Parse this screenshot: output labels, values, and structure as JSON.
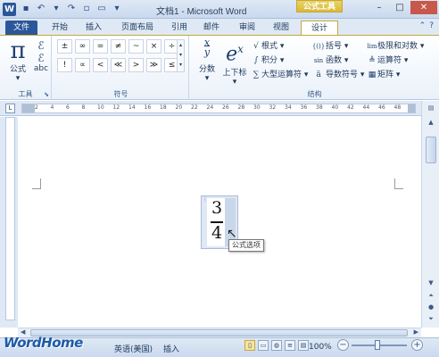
{
  "window": {
    "title": "文档1 - Microsoft Word",
    "context_tool": "公式工具",
    "app_logo": "W"
  },
  "tabs": [
    {
      "label": "文件"
    },
    {
      "label": "开始"
    },
    {
      "label": "插入"
    },
    {
      "label": "页面布局"
    },
    {
      "label": "引用"
    },
    {
      "label": "邮件"
    },
    {
      "label": "审阅"
    },
    {
      "label": "视图"
    },
    {
      "label": "设计"
    }
  ],
  "ribbon": {
    "tools": {
      "formula_label": "公式",
      "formula_symbol": "π",
      "abc_label": "abc",
      "group_label": "工具"
    },
    "symbols": {
      "group_label": "符号",
      "items": [
        "±",
        "∞",
        "=",
        "≠",
        "~",
        "×",
        "÷",
        "!",
        "∝",
        "<",
        "≪",
        ">",
        "≫",
        "≤"
      ]
    },
    "structures": {
      "group_label": "结构",
      "fraction": {
        "label": "分数",
        "icon": "x/y"
      },
      "script": {
        "label": "上下标",
        "icon": "eˣ"
      },
      "radical": {
        "label": "根式",
        "icon": "ⁿ√x"
      },
      "integral": {
        "label": "积分",
        "icon": "∫"
      },
      "large_operator": {
        "label": "大型运算符",
        "icon": "∑"
      },
      "bracket": {
        "label": "括号",
        "icon": "{()}"
      },
      "function": {
        "label": "函数",
        "icon": "sin"
      },
      "accent": {
        "label": "导数符号",
        "icon": "ä"
      },
      "limit_log": {
        "label": "极限和对数",
        "icon": "lim"
      },
      "operator": {
        "label": "运算符",
        "icon": "≜"
      },
      "matrix": {
        "label": "矩阵",
        "icon": "[]"
      }
    }
  },
  "ruler": {
    "numbers": [
      "2",
      "4",
      "6",
      "8",
      "10",
      "12",
      "14",
      "16",
      "18",
      "20",
      "22",
      "24",
      "26",
      "28",
      "30",
      "32",
      "34",
      "36",
      "38",
      "40",
      "42",
      "44",
      "46",
      "48"
    ]
  },
  "equation": {
    "numerator": "3",
    "denominator": "4",
    "tooltip": "公式选项"
  },
  "status": {
    "watermark": "WordHome",
    "language": "英语(美国)",
    "insert_mode": "插入",
    "zoom": "100%"
  }
}
